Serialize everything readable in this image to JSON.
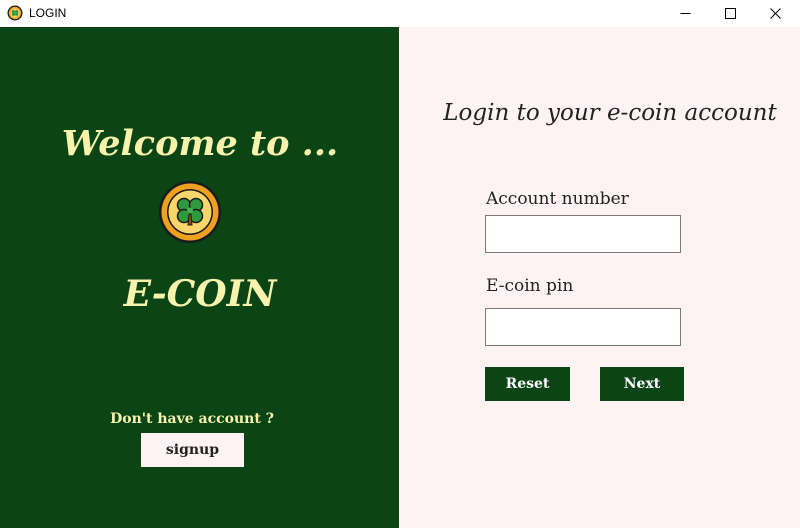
{
  "window": {
    "title": "LOGIN",
    "icon": "clover-coin-icon",
    "controls": [
      "minimize-icon",
      "maximize-icon",
      "close-icon"
    ]
  },
  "left_panel": {
    "welcome_text": "Welcome to ...",
    "logo_icon": "clover-coin-icon",
    "brand_name": "E-COIN",
    "signup_prompt": "Don't have account ?",
    "signup_label": "signup"
  },
  "login_form": {
    "heading": "Login to your e-coin account",
    "account_label": "Account number",
    "account_value": "",
    "pin_label": "E-coin pin",
    "pin_value": "",
    "reset_label": "Reset",
    "next_label": "Next"
  },
  "colors": {
    "panel_green": "#0c4515",
    "accent_yellow": "#f7f3ad",
    "form_background": "#fdf3f3"
  }
}
